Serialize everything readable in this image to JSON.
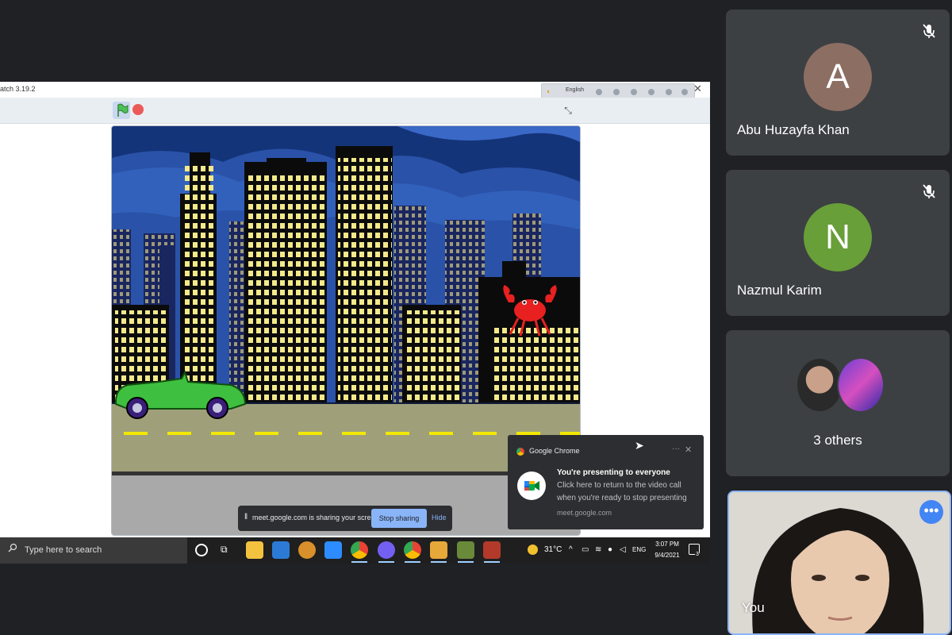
{
  "shared_screen": {
    "scratch_title": "atch 3.19.2",
    "language": "English"
  },
  "sharing_bar": {
    "message": "meet.google.com is sharing your screen.",
    "stop_label": "Stop sharing",
    "hide_label": "Hide"
  },
  "notification": {
    "app": "Google Chrome",
    "title": "You're presenting to everyone",
    "line1": "Click here to return to the video call",
    "line2": "when you're ready to stop presenting",
    "source": "meet.google.com"
  },
  "taskbar": {
    "search_placeholder": "Type here to search",
    "temperature": "31°C",
    "language": "ENG",
    "time": "3:07 PM",
    "date": "9/4/2021",
    "notification_count": "3"
  },
  "participants": [
    {
      "initial": "A",
      "name": "Abu Huzayfa Khan",
      "color": "#8d6e63",
      "muted": true
    },
    {
      "initial": "N",
      "name": "Nazmul Karim",
      "color": "#689f38",
      "muted": true
    }
  ],
  "others": {
    "label": "3 others"
  },
  "self": {
    "name": "You"
  },
  "colors": {
    "accent": "#8ab4f8",
    "background": "#202124",
    "tile": "#3c4043"
  }
}
